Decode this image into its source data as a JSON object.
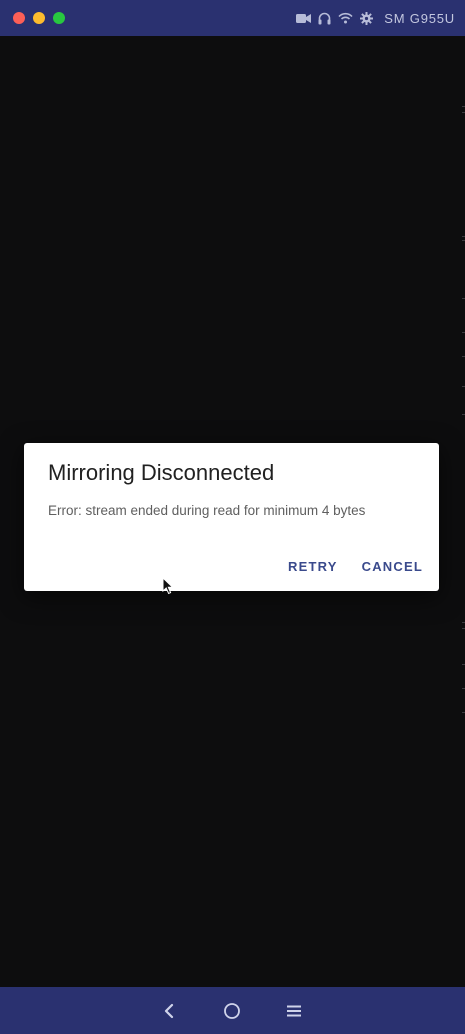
{
  "device": {
    "name": "SM G955U"
  },
  "status_icons": [
    "video-camera-icon",
    "headphones-icon",
    "wifi-icon",
    "gear-icon"
  ],
  "dialog": {
    "title": "Mirroring Disconnected",
    "message": "Error: stream ended during read for minimum 4 bytes",
    "retry_label": "RETRY",
    "cancel_label": "CANCEL"
  },
  "navbar": {
    "buttons": [
      "back-icon",
      "home-icon",
      "recents-icon"
    ]
  },
  "colors": {
    "titlebar": "#2a3170",
    "screen": "#0d0d0e",
    "dialog_button": "#3a4a8c"
  }
}
